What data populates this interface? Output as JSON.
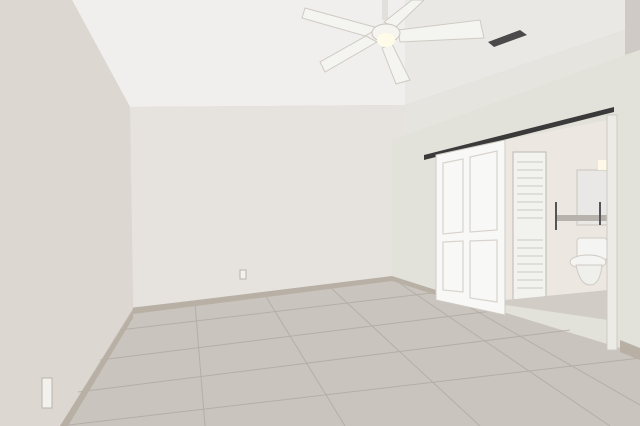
{
  "scene": {
    "colors": {
      "ceiling": "#f1efed",
      "upper_ceiling_right": "#e4e2dc",
      "left_wall": "#ddd7d2",
      "back_wall": "#e6e2dd",
      "right_wall": "#e2e2da",
      "baseboard": "#b8b0a5",
      "floor": "#c9c4bd",
      "grout": "#aca69e",
      "barn_door": "#f8f8f6",
      "door_rail": "#3a3a3a",
      "bathroom_wall": "#ede7e2",
      "toilet": "#f4f4f2",
      "fan_blade": "#f4f4f0"
    },
    "icons": [
      "ceiling-fan-icon",
      "air-vent-icon",
      "power-outlet-icon",
      "toilet-icon",
      "grab-bar-icon"
    ]
  }
}
